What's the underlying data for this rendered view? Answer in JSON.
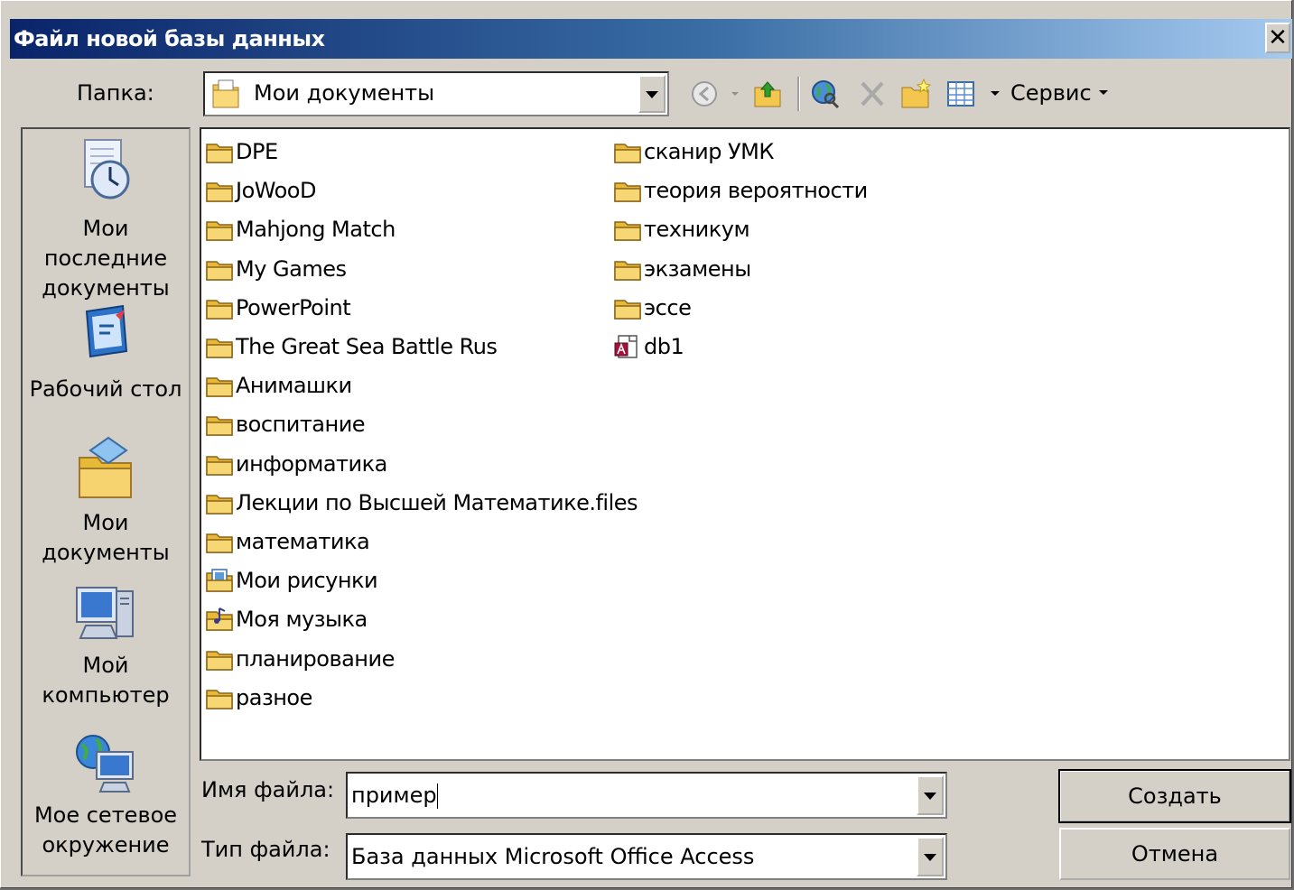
{
  "window": {
    "title": "Файл новой базы данных",
    "close_label": "✕"
  },
  "toolbar": {
    "folder_label": "Папка:",
    "folder_value": "Мои документы",
    "service_label": "Сервис"
  },
  "places": [
    {
      "label1": "Мои последние",
      "label2": "документы",
      "icon": "recent-documents-icon"
    },
    {
      "label1": "Рабочий стол",
      "label2": "",
      "icon": "desktop-icon"
    },
    {
      "label1": "Мои",
      "label2": "документы",
      "icon": "my-documents-icon"
    },
    {
      "label1": "Мой",
      "label2": "компьютер",
      "icon": "my-computer-icon"
    },
    {
      "label1": "Мое сетевое",
      "label2": "окружение",
      "icon": "network-places-icon"
    }
  ],
  "files_col1": [
    {
      "name": "DPE",
      "icon": "folder-icon"
    },
    {
      "name": "JoWooD",
      "icon": "folder-icon"
    },
    {
      "name": "Mahjong Match",
      "icon": "folder-icon"
    },
    {
      "name": "My Games",
      "icon": "folder-icon"
    },
    {
      "name": "PowerPoint",
      "icon": "folder-icon"
    },
    {
      "name": "The Great Sea Battle Rus",
      "icon": "folder-icon"
    },
    {
      "name": "Анимашки",
      "icon": "folder-icon"
    },
    {
      "name": "воспитание",
      "icon": "folder-icon"
    },
    {
      "name": "информатика",
      "icon": "folder-icon"
    },
    {
      "name": "Лекции по Высшей Математике.files",
      "icon": "folder-icon"
    },
    {
      "name": "математика",
      "icon": "folder-icon"
    },
    {
      "name": "Мои рисунки",
      "icon": "pictures-folder-icon"
    },
    {
      "name": "Моя музыка",
      "icon": "music-folder-icon"
    },
    {
      "name": "планирование",
      "icon": "folder-icon"
    },
    {
      "name": "разное",
      "icon": "folder-icon"
    }
  ],
  "files_col2": [
    {
      "name": "сканир УМК",
      "icon": "folder-icon"
    },
    {
      "name": "теория вероятности",
      "icon": "folder-icon"
    },
    {
      "name": "техникум",
      "icon": "folder-icon"
    },
    {
      "name": "экзамены",
      "icon": "folder-icon"
    },
    {
      "name": "эссе",
      "icon": "folder-icon"
    },
    {
      "name": "db1",
      "icon": "access-database-icon"
    }
  ],
  "form": {
    "filename_label": "Имя файла:",
    "filename_value": "пример",
    "filetype_label": "Тип файла:",
    "filetype_value": "База данных Microsoft Office Access"
  },
  "buttons": {
    "create_pre": "Соз",
    "create_accel": "д",
    "create_post": "ать",
    "cancel": "Отмена"
  }
}
